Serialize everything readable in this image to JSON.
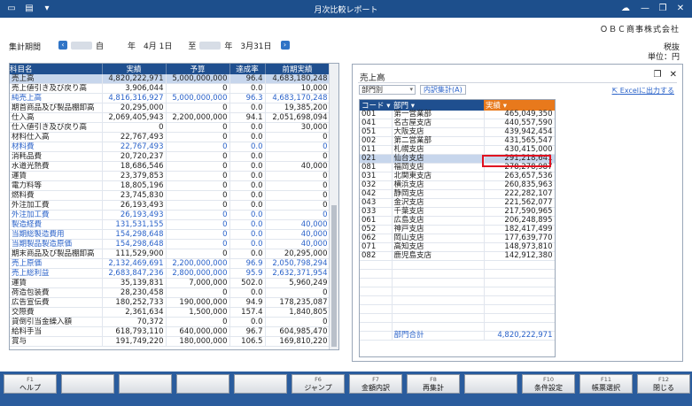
{
  "window": {
    "title": "月次比較レポート",
    "company": "ＯＢＣ商事株式会社"
  },
  "header": {
    "period_label": "集計期間",
    "period_from": "自　　　年　4月 1日",
    "period_sep": "至",
    "period_to": "年　3月31日",
    "tax_label": "税抜",
    "unit_label": "単位：円"
  },
  "left_table": {
    "headers": [
      "科目名",
      "実績",
      "予算",
      "達成率",
      "前期実績"
    ],
    "rows": [
      [
        "売上高",
        "4,820,222,971",
        "5,000,000,000",
        "96.4",
        "4,683,180,248"
      ],
      [
        "売上値引き及び戻り高",
        "3,906,044",
        "0",
        "0.0",
        "10,000"
      ],
      [
        "純売上高",
        "4,816,316,927",
        "5,000,000,000",
        "96.3",
        "4,683,170,248"
      ],
      [
        "期首商品及び製品棚卸高",
        "20,295,000",
        "0",
        "0.0",
        "19,385,200"
      ],
      [
        "仕入高",
        "2,069,405,943",
        "2,200,000,000",
        "94.1",
        "2,051,698,094"
      ],
      [
        "仕入値引き及び戻り高",
        "0",
        "0",
        "0.0",
        "30,000"
      ],
      [
        "材料仕入高",
        "22,767,493",
        "0",
        "0.0",
        "0"
      ],
      [
        "材料費",
        "22,767,493",
        "0",
        "0.0",
        "0"
      ],
      [
        "消耗品費",
        "20,720,237",
        "0",
        "0.0",
        "0"
      ],
      [
        "水道光熱費",
        "18,686,546",
        "0",
        "0.0",
        "40,000"
      ],
      [
        "運賃",
        "23,379,853",
        "0",
        "0.0",
        "0"
      ],
      [
        "電力料等",
        "18,805,196",
        "0",
        "0.0",
        "0"
      ],
      [
        "燃料費",
        "23,745,830",
        "0",
        "0.0",
        "0"
      ],
      [
        "外注加工費",
        "26,193,493",
        "0",
        "0.0",
        "0"
      ],
      [
        "外注加工費",
        "26,193,493",
        "0",
        "0.0",
        "0"
      ],
      [
        "製造経費",
        "131,531,155",
        "0",
        "0.0",
        "40,000"
      ],
      [
        "当期総製造費用",
        "154,298,648",
        "0",
        "0.0",
        "40,000"
      ],
      [
        "当期製品製造原価",
        "154,298,648",
        "0",
        "0.0",
        "40,000"
      ],
      [
        "期末商品及び製品棚卸高",
        "111,529,900",
        "0",
        "0.0",
        "20,295,000"
      ],
      [
        "売上原価",
        "2,132,469,691",
        "2,200,000,000",
        "96.9",
        "2,050,798,294"
      ],
      [
        "売上総利益",
        "2,683,847,236",
        "2,800,000,000",
        "95.9",
        "2,632,371,954"
      ],
      [
        "運賃",
        "35,139,831",
        "7,000,000",
        "502.0",
        "5,960,249"
      ],
      [
        "荷造包装費",
        "28,230,458",
        "0",
        "0.0",
        "0"
      ],
      [
        "広告宣伝費",
        "180,252,733",
        "190,000,000",
        "94.9",
        "178,235,087"
      ],
      [
        "交際費",
        "2,361,634",
        "1,500,000",
        "157.4",
        "1,840,805"
      ],
      [
        "貸倒引当金繰入額",
        "70,372",
        "0",
        "0.0",
        "0"
      ],
      [
        "給料手当",
        "618,793,110",
        "640,000,000",
        "96.7",
        "604,985,470"
      ],
      [
        "賞与",
        "191,749,220",
        "180,000,000",
        "106.5",
        "169,810,220"
      ]
    ]
  },
  "right_panel": {
    "title": "売上高",
    "dropdown": "部門別",
    "detail_button": "内訳集計(A)",
    "excel_link": "Excelに出力する",
    "headers": [
      "コード",
      "部門",
      "実績"
    ],
    "rows": [
      [
        "001",
        "第一営業部",
        "465,049,350"
      ],
      [
        "041",
        "名古屋支店",
        "440,557,590"
      ],
      [
        "051",
        "大阪支店",
        "439,942,454"
      ],
      [
        "002",
        "第二営業部",
        "431,565,547"
      ],
      [
        "011",
        "札幌支店",
        "430,415,000"
      ],
      [
        "021",
        "仙台支店",
        "291,218,641"
      ],
      [
        "081",
        "福岡支店",
        "278,278,987"
      ],
      [
        "031",
        "北関東支店",
        "263,657,536"
      ],
      [
        "032",
        "横浜支店",
        "260,835,963"
      ],
      [
        "042",
        "静岡支店",
        "222,282,107"
      ],
      [
        "043",
        "金沢支店",
        "221,562,077"
      ],
      [
        "033",
        "千葉支店",
        "217,590,965"
      ],
      [
        "061",
        "広島支店",
        "206,248,895"
      ],
      [
        "052",
        "神戸支店",
        "182,417,499"
      ],
      [
        "062",
        "岡山支店",
        "177,639,770"
      ],
      [
        "071",
        "高知支店",
        "148,973,810"
      ],
      [
        "082",
        "鹿児島支店",
        "142,912,380"
      ]
    ],
    "total_label": "部門合計",
    "total_value": "4,820,222,971"
  },
  "fkeys": [
    {
      "k": "F1",
      "l": "ヘルプ"
    },
    {
      "k": "",
      "l": ""
    },
    {
      "k": "",
      "l": ""
    },
    {
      "k": "",
      "l": ""
    },
    {
      "k": "",
      "l": ""
    },
    {
      "k": "F6",
      "l": "ジャンプ"
    },
    {
      "k": "F7",
      "l": "金額内訳"
    },
    {
      "k": "F8",
      "l": "再集計"
    },
    {
      "k": "",
      "l": ""
    },
    {
      "k": "F10",
      "l": "条件設定"
    },
    {
      "k": "F11",
      "l": "帳票選択"
    },
    {
      "k": "F12",
      "l": "閉じる"
    }
  ]
}
